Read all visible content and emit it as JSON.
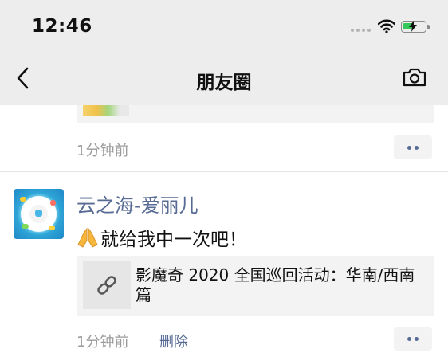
{
  "status_bar": {
    "time": "12:46",
    "battery_level_percent": 45,
    "battery_color": "#34c759",
    "icons": [
      "signal-dots-icon",
      "wifi-icon",
      "battery-charging-icon"
    ]
  },
  "nav": {
    "title": "朋友圈",
    "back_icon": "chevron-left-icon",
    "camera_icon": "camera-icon"
  },
  "colors": {
    "link_blue": "#576b95",
    "meta_gray": "#9a9a9a",
    "bar_bg": "#ededed"
  },
  "feed": [
    {
      "time": "1分钟前",
      "more_icon": "more-dots-icon"
    },
    {
      "username": "云之海-爱丽儿",
      "emoji_icon": "praying-hands-emoji",
      "text": "就给我中一次吧！",
      "link_title": "影魔奇 2020 全国巡回活动：华南/西南篇",
      "link_icon": "link-icon",
      "time": "1分钟前",
      "delete_label": "删除",
      "more_icon": "more-dots-icon"
    }
  ]
}
